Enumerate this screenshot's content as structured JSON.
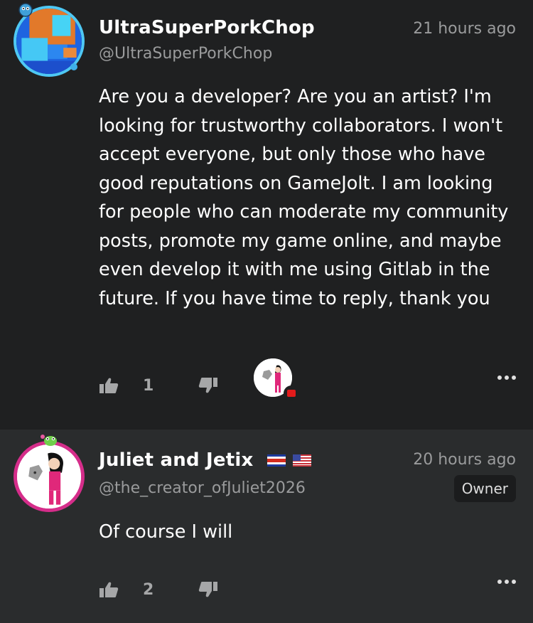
{
  "comments": [
    {
      "name": "UltraSuperPorkChop",
      "handle": "@UltraSuperPorkChop",
      "time": "21 hours ago",
      "text": "Are you a developer? Are you an artist? I'm looking for trustworthy collaborators. I won't accept everyone, but only those who have good reputations on GameJolt. I am looking for people who can moderate my community posts, promote my game online, and maybe even develop it with me using Gitlab in the future. If you have time to reply, thank you",
      "likes": "1"
    },
    {
      "name": "Juliet and Jetix",
      "handle": "@the_creator_ofJuliet2026",
      "time": "20 hours ago",
      "tag": "Owner",
      "text": "Of course I will",
      "likes": "2"
    }
  ],
  "icons": {
    "like": "thumbs-up-icon",
    "dislike": "thumbs-down-icon",
    "more": "more-dots-icon"
  },
  "colors": {
    "background": "#1f2021",
    "reply_background": "#2a2c2d",
    "muted_text": "#9a9b9c"
  }
}
